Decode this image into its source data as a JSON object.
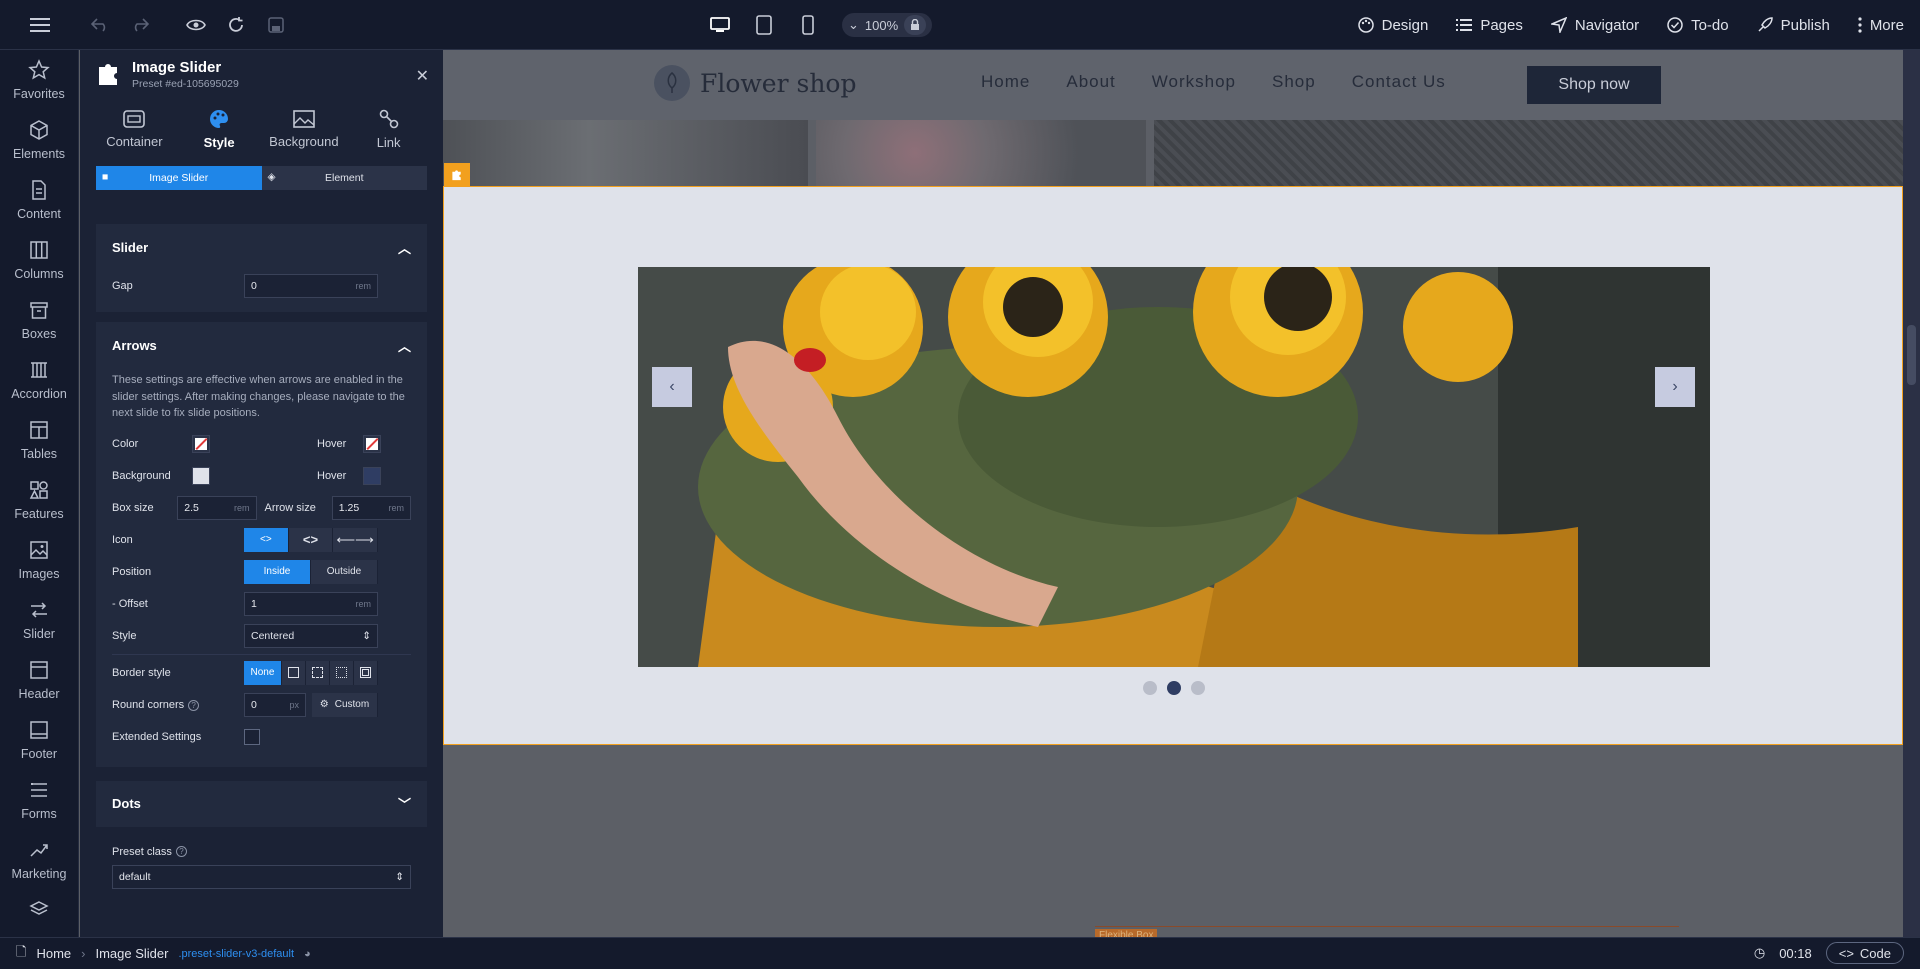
{
  "topbar": {
    "zoom": "100%",
    "actions": [
      "Design",
      "Pages",
      "Navigator",
      "To-do",
      "Publish",
      "More"
    ]
  },
  "rail": {
    "items": [
      "Favorites",
      "Elements",
      "Content",
      "Columns",
      "Boxes",
      "Accordion",
      "Tables",
      "Features",
      "Images",
      "Slider",
      "Header",
      "Footer",
      "Forms",
      "Marketing"
    ]
  },
  "panel": {
    "title": "Image Slider",
    "preset": "Preset #ed-105695029",
    "tabs": [
      "Container",
      "Style",
      "Background",
      "Link"
    ],
    "active_tab": "Style",
    "segments": [
      "Image Slider",
      "Element"
    ],
    "slider": {
      "heading": "Slider",
      "gap_label": "Gap",
      "gap_value": "0",
      "gap_unit": "rem"
    },
    "arrows": {
      "heading": "Arrows",
      "note": "These settings are effective when arrows are enabled in the slider settings. After making changes, please navigate to the next slide to fix slide positions.",
      "color_label": "Color",
      "hover_label": "Hover",
      "background_label": "Background",
      "box_size_label": "Box size",
      "box_size_value": "2.5",
      "arrow_size_label": "Arrow size",
      "arrow_size_value": "1.25",
      "unit": "rem",
      "icon_label": "Icon",
      "position_label": "Position",
      "position_options": [
        "Inside",
        "Outside"
      ],
      "offset_label": "- Offset",
      "offset_value": "1",
      "style_label": "Style",
      "style_value": "Centered",
      "border_style_label": "Border style",
      "border_none": "None",
      "round_corners_label": "Round corners",
      "round_corners_value": "0",
      "round_unit": "px",
      "custom_label": "Custom",
      "extended_label": "Extended Settings"
    },
    "dots": {
      "heading": "Dots"
    },
    "preset_class": {
      "label": "Preset class",
      "value": "default"
    }
  },
  "site": {
    "brand": "Flower shop",
    "menu": [
      "Home",
      "About",
      "Workshop",
      "Shop",
      "Contact Us"
    ],
    "cta": "Shop now",
    "flexbox_tag": "Flexible Box"
  },
  "statusbar": {
    "home": "Home",
    "current": "Image Slider",
    "class": ".preset-slider-v3-default",
    "time": "00:18",
    "code": "Code"
  },
  "colors": {
    "accent": "#1f86e8",
    "selection": "#f2a01e",
    "panel_bg": "#1b2235"
  }
}
